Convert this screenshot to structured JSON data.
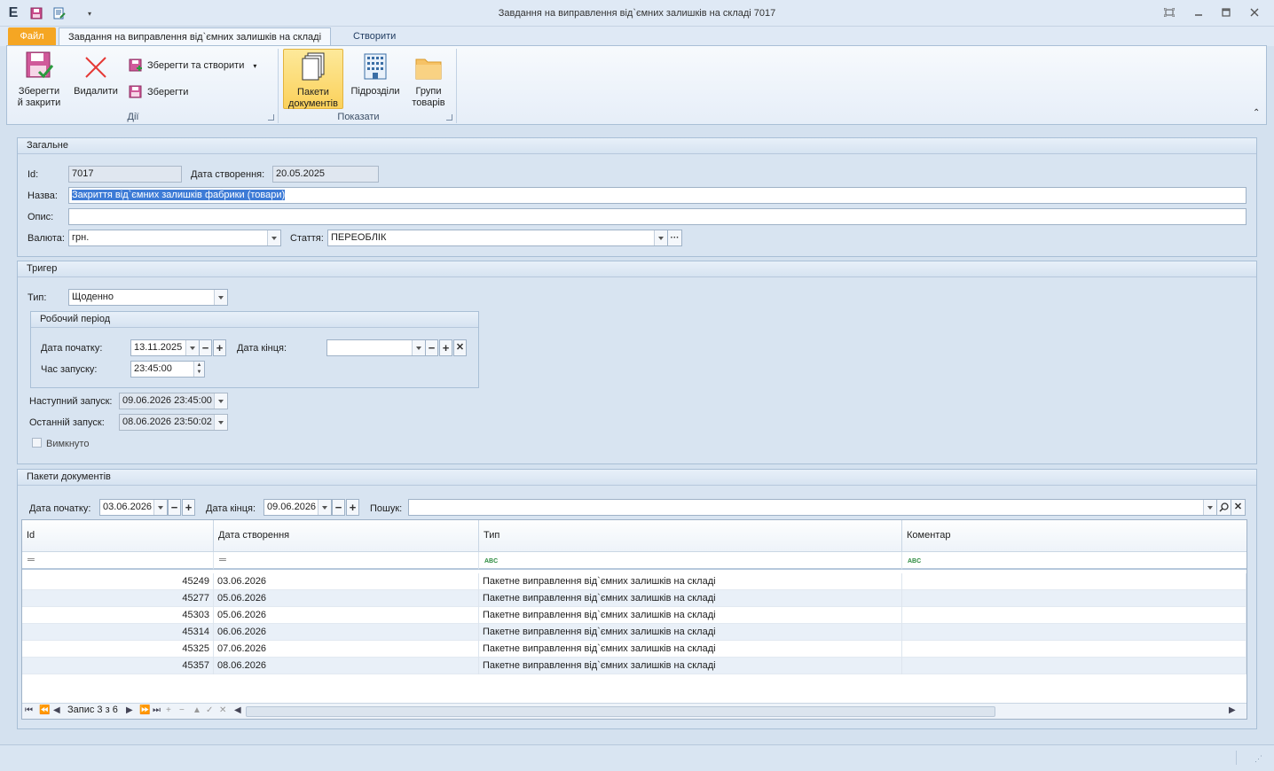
{
  "window": {
    "title": "Завдання на виправлення від`ємних залишків на складі 7017",
    "app_letter": "E"
  },
  "tabs": {
    "file": "Файл",
    "active": "Завдання на виправлення від`ємних залишків на складі",
    "create": "Створити"
  },
  "ribbon": {
    "save_close": "Зберегти\nй закрити",
    "delete": "Видалити",
    "save_create": "Зберегти та створити",
    "save": "Зберегти",
    "group_actions": "Дії",
    "doc_packages": "Пакети\nдокументів",
    "departments": "Підрозділи",
    "product_groups": "Групи\nтоварів",
    "group_show": "Показати"
  },
  "general": {
    "header": "Загальне",
    "id_label": "Id:",
    "id_value": "7017",
    "created_label": "Дата створення:",
    "created_value": "20.05.2025",
    "name_label": "Назва:",
    "name_value": "Закриття від`ємних залишків фабрики (товари)",
    "desc_label": "Опис:",
    "desc_value": "",
    "currency_label": "Валюта:",
    "currency_value": "грн.",
    "article_label": "Стаття:",
    "article_value": "ПЕРЕОБЛІК"
  },
  "trigger": {
    "header": "Тригер",
    "type_label": "Тип:",
    "type_value": "Щоденно",
    "work_period": "Робочий період",
    "start_label": "Дата початку:",
    "start_value": "13.11.2025",
    "end_label": "Дата кінця:",
    "end_value": "",
    "time_label": "Час запуску:",
    "time_value": "23:45:00",
    "next_label": "Наступний запуск:",
    "next_value": "09.06.2026 23:45:00",
    "last_label": "Останній запуск:",
    "last_value": "08.06.2026 23:50:02",
    "disabled_label": "Вимкнуто"
  },
  "packages": {
    "header": "Пакети документів",
    "start_label": "Дата початку:",
    "start_value": "03.06.2026",
    "end_label": "Дата кінця:",
    "end_value": "09.06.2026",
    "search_label": "Пошук:",
    "search_value": "",
    "columns": [
      "Id",
      "Дата створення",
      "Тип",
      "Коментар"
    ],
    "rows": [
      {
        "id": "45249",
        "date": "03.06.2026",
        "type": "Пакетне виправлення від`ємних залишків на складі",
        "comment": ""
      },
      {
        "id": "45277",
        "date": "05.06.2026",
        "type": "Пакетне виправлення від`ємних залишків на складі",
        "comment": ""
      },
      {
        "id": "45303",
        "date": "05.06.2026",
        "type": "Пакетне виправлення від`ємних залишків на складі",
        "comment": ""
      },
      {
        "id": "45314",
        "date": "06.06.2026",
        "type": "Пакетне виправлення від`ємних залишків на складі",
        "comment": ""
      },
      {
        "id": "45325",
        "date": "07.06.2026",
        "type": "Пакетне виправлення від`ємних залишків на складі",
        "comment": ""
      },
      {
        "id": "45357",
        "date": "08.06.2026",
        "type": "Пакетне виправлення від`ємних залишків на складі",
        "comment": ""
      }
    ],
    "record_text": "Запис 3 з 6"
  },
  "colors": {
    "accent": "#f5a623",
    "selected": "#fbd15b",
    "border": "#a9bfd6"
  }
}
